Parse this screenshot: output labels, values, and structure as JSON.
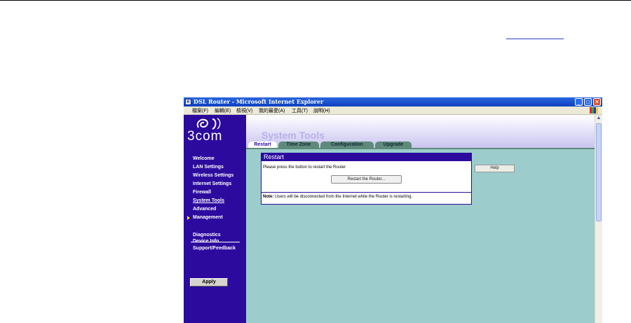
{
  "window": {
    "title": "DSL Router - Microsoft Internet Explorer",
    "controls": {
      "minimize": "_",
      "maximize": "□",
      "close": "✕"
    }
  },
  "menubar": [
    "檔案(F)",
    "編輯(E)",
    "檢視(V)",
    "我的最愛(A)",
    "工具(T)",
    "說明(H)"
  ],
  "brand": {
    "name": "3com"
  },
  "sidebar": {
    "items": [
      "Welcome",
      "LAN Settings",
      "Wireless Settings",
      "Internet Settings",
      "Firewall",
      "System Tools",
      "Advanced",
      "Management"
    ],
    "active": "System Tools",
    "secondary": [
      "Diagnostics",
      "Device Info",
      "Support/Feedback"
    ],
    "apply_label": "Apply"
  },
  "page": {
    "heading": "System Tools"
  },
  "tabs": [
    "Restart",
    "Time Zone",
    "Configuration",
    "Upgrade"
  ],
  "panel": {
    "title": "Restart",
    "instruction": "Please press the button to restart the Router",
    "restart_button": "Restart the Router...",
    "note_label": "Note:",
    "note_text": " Users will be disconnected from the Internet while the Router is restarting."
  },
  "help_label": "Help",
  "colors": {
    "sidebar": "#2c0a9e",
    "content_bg": "#9ccccc",
    "tab": "#5e8a7a",
    "heading": "#b8b0e8"
  }
}
